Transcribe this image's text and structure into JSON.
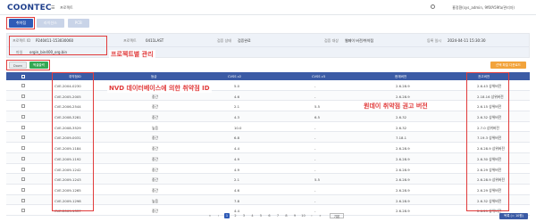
{
  "app": {
    "logo": "COONTEC",
    "menu_icon": "hamburger-icon",
    "title": "프로젝트",
    "user": "홍정환(sys_admin, 9f6fA59fa/관리자)"
  },
  "tabs": [
    {
      "label": "취약점"
    },
    {
      "label": "라이선스"
    },
    {
      "label": "PCB"
    }
  ],
  "project": {
    "id_label": "프로젝트 ID",
    "id_value": "P240411-153030060",
    "version_label": "프로젝트",
    "version_value": "0411LAST",
    "status_label": "검증 상태",
    "status_value": "검증완료",
    "source_label": "검증 대상",
    "source_value": "웹페이 버전/취약점",
    "date_label": "등록 일시",
    "date_value": "2024-04-11 15:30:30",
    "file_label": "파일",
    "file_value": "orgin_bin400_org.bin"
  },
  "annotations": {
    "project_mgmt": "프로젝트별 관리",
    "nvd_id": "NVD 데이터베이스에 의한 취약점 ID",
    "advisory": "원데이 취약점 권고 버전"
  },
  "buttons": {
    "download": "Down",
    "excel": "엑셀출력",
    "right": "선택 파일 다운로드"
  },
  "table": {
    "headers": [
      "",
      "취약점ID",
      "등급",
      "CVSS v2",
      "CVSS v3",
      "현재버전",
      "권고버전"
    ],
    "rows": [
      [
        "CVE-2004-0230",
        "중간",
        "5.0",
        "-",
        "2.6.28.9",
        "2.6.43 상위버전"
      ],
      [
        "CVE-2005-2005",
        "중간",
        "4.6",
        "-",
        "2.6.28.9",
        "2.18.16 상위버전"
      ],
      [
        "CVE-2006-2544",
        "중간",
        "2.1",
        "5.5",
        "2.6.28.9",
        "2.6.15 상위버전"
      ],
      [
        "CVE-2008-3281",
        "중간",
        "4.3",
        "6.5",
        "2.6.32",
        "2.6.32 상위버전"
      ],
      [
        "CVE-2008-3529",
        "높음",
        "10.0",
        "-",
        "2.6.32",
        "2.7.0 상위버전"
      ],
      [
        "CVE-2009-0031",
        "중간",
        "6.8",
        "-",
        "7.18.1",
        "7.19.3 상위버전"
      ],
      [
        "CVE-2009-1184",
        "중간",
        "4.4",
        "-",
        "2.6.28.9",
        "2.6.28.9 상위버전"
      ],
      [
        "CVE-2009-1192",
        "중간",
        "4.9",
        "-",
        "2.6.28.9",
        "2.6.30 상위버전"
      ],
      [
        "CVE-2009-1242",
        "중간",
        "4.9",
        "-",
        "2.6.28.9",
        "2.6.29 상위버전"
      ],
      [
        "CVE-2009-1243",
        "중간",
        "2.1",
        "5.5",
        "2.6.28.9",
        "2.6.28.9 상위버전"
      ],
      [
        "CVE-2009-1265",
        "중간",
        "4.6",
        "-",
        "2.6.28.9",
        "2.6.29 상위버전"
      ],
      [
        "CVE-2009-1298",
        "높음",
        "7.8",
        "-",
        "2.6.28.9",
        "2.6.32 상위버전"
      ],
      [
        "CVE-2009-1337",
        "중간",
        "4.4",
        "-",
        "2.6.28.9",
        "2.6.29 상위버전"
      ]
    ]
  },
  "pager": {
    "pages": [
      "«",
      "‹",
      "1",
      "2",
      "3",
      "4",
      "5",
      "6",
      "7",
      "8",
      "9",
      "10",
      "›",
      "»"
    ],
    "active": "1",
    "page_size": "기본"
  },
  "footer_button": "목록 (= 10원)",
  "colors": {
    "primary": "#2f5bb7",
    "header": "#3b5ba5",
    "highlight": "#e13b3b",
    "excel": "#34a853",
    "orange": "#f2a33b"
  }
}
